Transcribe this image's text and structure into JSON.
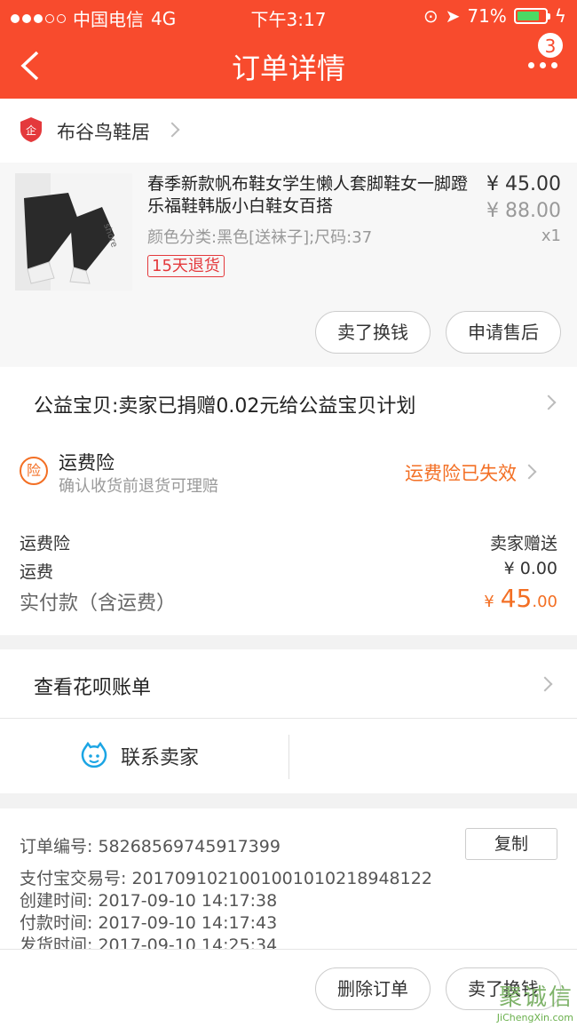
{
  "status_bar": {
    "carrier": "中国电信",
    "network": "4G",
    "time": "下午3:17",
    "battery": "71%"
  },
  "nav": {
    "title": "订单详情",
    "badge_count": "3"
  },
  "shop": {
    "name": "布谷鸟鞋居"
  },
  "item": {
    "title": "春季新款帆布鞋女学生懒人套脚鞋女一脚蹬乐福鞋韩版小白鞋女百搭",
    "sku": "颜色分类:黑色[送袜子];尺码:37",
    "tag": "15天退货",
    "price": "¥ 45.00",
    "original_price": "¥ 88.00",
    "quantity": "x1",
    "buttons": [
      "卖了换钱",
      "申请售后"
    ]
  },
  "charity": {
    "text": "公益宝贝:卖家已捐赠0.02元给公益宝贝计划"
  },
  "insurance": {
    "icon_char": "险",
    "title": "运费险",
    "subtitle": "确认收货前退货可理赔",
    "status": "运费险已失效"
  },
  "fees": {
    "rows": [
      {
        "label": "运费险",
        "value": "卖家赠送"
      },
      {
        "label": "运费",
        "value": "¥ 0.00"
      }
    ],
    "total_label": "实付款（含运费）",
    "total_currency": "¥",
    "total_int": "45",
    "total_dec": ".00"
  },
  "huabei": {
    "label": "查看花呗账单"
  },
  "contact": {
    "label": "联系卖家"
  },
  "order_info": {
    "order_no": "订单编号:   58268569745917399",
    "alipay_no": "支付宝交易号:   2017091021001001010218948122",
    "created": "创建时间:   2017-09-10 14:17:38",
    "paid": "付款时间:   2017-09-10 14:17:43",
    "shipped": "发货时间:   2017-09-10 14:25:34",
    "copy_label": "复制"
  },
  "bottom_bar": {
    "buttons": [
      "删除订单",
      "卖了换钱"
    ]
  },
  "watermark": {
    "chars": "聚诚信",
    "url": "JiChengXin.com"
  },
  "colors": {
    "brand": "#f84b2d",
    "accent": "#f36f24"
  }
}
